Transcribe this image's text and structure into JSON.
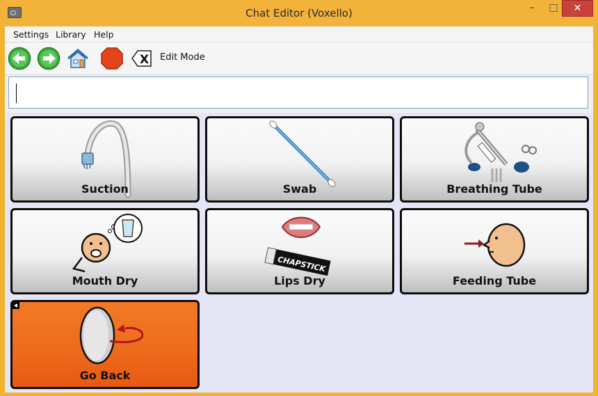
{
  "window": {
    "title": "Chat Editor (Voxello)",
    "minimize_label": "–",
    "maximize_label": "□",
    "close_label": "✕"
  },
  "menu": {
    "items": [
      "Settings",
      "Library",
      "Help"
    ]
  },
  "toolbar": {
    "edit_mode_label": "Edit Mode",
    "clear_label": "X"
  },
  "message": {
    "text": ""
  },
  "tiles": [
    {
      "label": "Suction",
      "icon": "suction-tube-icon"
    },
    {
      "label": "Swab",
      "icon": "cotton-swab-icon"
    },
    {
      "label": "Breathing Tube",
      "icon": "breathing-tube-icon"
    },
    {
      "label": "Mouth Dry",
      "icon": "thirsty-person-icon"
    },
    {
      "label": "Lips Dry",
      "icon": "lips-chapstick-icon"
    },
    {
      "label": "Feeding Tube",
      "icon": "feeding-tube-icon"
    },
    {
      "label": "Go Back",
      "icon": "go-back-icon"
    }
  ],
  "chapstick_text": "CHAPSTICK",
  "colors": {
    "titlebar": "#f3b23a",
    "grid_background": "#e4e6f6",
    "go_back_tile": "#f07020",
    "close_button": "#c7423a"
  }
}
